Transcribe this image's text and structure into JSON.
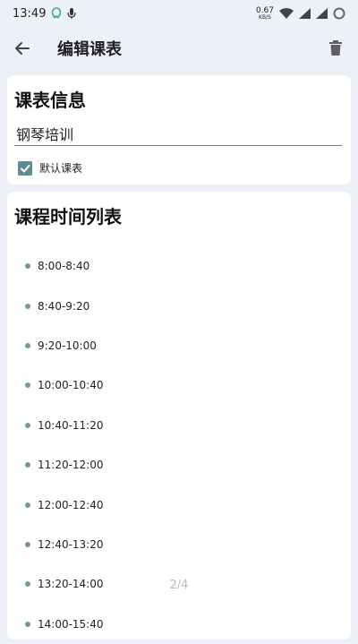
{
  "status_bar": {
    "time": "13:49",
    "speed_value": "0.67",
    "speed_unit": "KB/S"
  },
  "app_bar": {
    "back_icon": "arrow-left-icon",
    "title": "编辑课表",
    "delete_icon": "trash-icon"
  },
  "info_card": {
    "title": "课表信息",
    "name_value": "钢琴培训",
    "default_checked": true,
    "default_label": "默认课表"
  },
  "list_card": {
    "title": "课程时间列表",
    "items": [
      {
        "label": "8:00-8:40"
      },
      {
        "label": "8:40-9:20"
      },
      {
        "label": "9:20-10:00"
      },
      {
        "label": "10:00-10:40"
      },
      {
        "label": "10:40-11:20"
      },
      {
        "label": "11:20-12:00"
      },
      {
        "label": "12:00-12:40"
      },
      {
        "label": "12:40-13:20"
      },
      {
        "label": "13:20-14:00"
      },
      {
        "label": "14:00-15:40"
      }
    ]
  },
  "page_indicator": "2/4",
  "colors": {
    "accent": "#5d8b92",
    "background": "#eef0f8"
  }
}
